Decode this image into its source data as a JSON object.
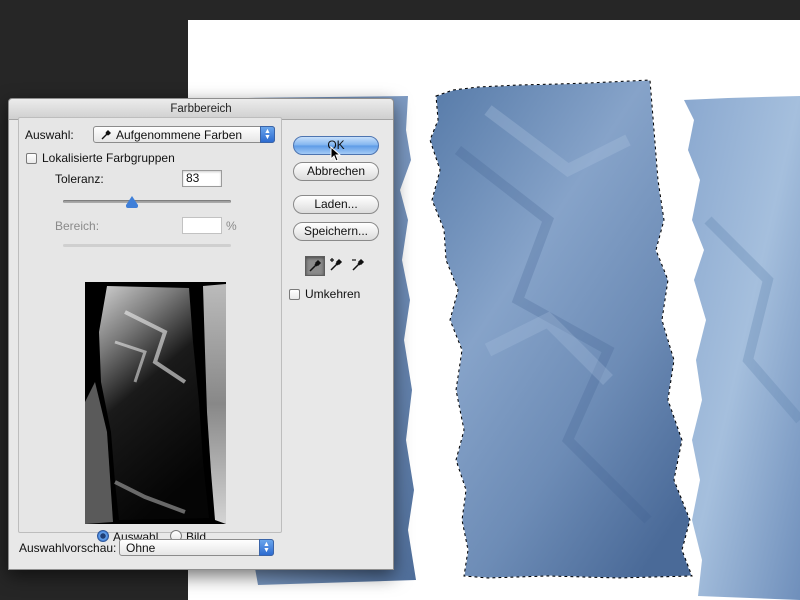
{
  "dialog": {
    "title": "Farbbereich",
    "select_label": "Auswahl:",
    "select_value": "Aufgenommene Farben",
    "select_icon": "eyedropper-icon",
    "localized_label": "Lokalisierte Farbgruppen",
    "localized_checked": false,
    "tolerance_label": "Toleranz:",
    "tolerance_value": "83",
    "range_label": "Bereich:",
    "range_value": "",
    "range_unit": "%",
    "view_options": [
      {
        "label": "Auswahl",
        "selected": true
      },
      {
        "label": "Bild",
        "selected": false
      }
    ],
    "preview_label": "Auswahlvorschau:",
    "preview_value": "Ohne"
  },
  "buttons": {
    "ok": "OK",
    "cancel": "Abbrechen",
    "load": "Laden...",
    "save": "Speichern..."
  },
  "tools": [
    {
      "name": "eyedropper-icon",
      "active": true
    },
    {
      "name": "eyedropper-plus-icon",
      "active": false
    },
    {
      "name": "eyedropper-minus-icon",
      "active": false
    }
  ],
  "invert_label": "Umkehren",
  "invert_checked": false,
  "colors": {
    "accent": "#3f7fd8",
    "paper": "#6f8fb8",
    "canvas_background": "#ffffff",
    "workspace": "#262626"
  }
}
